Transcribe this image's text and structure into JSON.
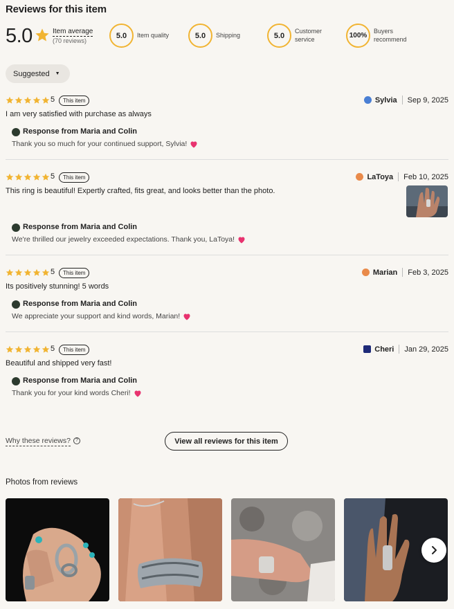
{
  "header": {
    "title": "Reviews for this item"
  },
  "summary": {
    "score": "5.0",
    "avg_label": "Item average",
    "count": "(70 reviews)",
    "star_color": "#f1b432"
  },
  "metrics": [
    {
      "value": "5.0",
      "label": "Item quality"
    },
    {
      "value": "5.0",
      "label": "Shipping"
    },
    {
      "value": "5.0",
      "label_line1": "Customer",
      "label_line2": "service"
    },
    {
      "value": "100%",
      "label_line1": "Buyers",
      "label_line2": "recommend"
    }
  ],
  "sort": {
    "label": "Suggested",
    "caret_icon": "caret-down-icon"
  },
  "reviews": [
    {
      "rating": "5",
      "badge": "This item",
      "text": "I am very satisfied with purchase as always",
      "author": "Sylvia",
      "date": "Sep 9, 2025",
      "avatar_color": "#4a7fd4",
      "response_heading": "Response from Maria and Colin",
      "response_text": "Thank you so much for your continued support, Sylvia!"
    },
    {
      "rating": "5",
      "badge": "This item",
      "text": "This ring is beautiful! Expertly crafted, fits great, and looks better than the photo.",
      "author": "LaToya",
      "date": "Feb 10, 2025",
      "avatar_color": "#e98a4a",
      "response_heading": "Response from Maria and Colin",
      "response_text": "We're thrilled our jewelry exceeded expectations. Thank you, LaToya!"
    },
    {
      "rating": "5",
      "badge": "This item",
      "text": "Its positively stunning! 5 words",
      "author": "Marian",
      "date": "Feb 3, 2025",
      "avatar_color": "#e98a4a",
      "response_heading": "Response from Maria and Colin",
      "response_text": "We appreciate your support and kind words, Marian!"
    },
    {
      "rating": "5",
      "badge": "This item",
      "text": "Beautiful and shipped very fast!",
      "author": "Cheri",
      "date": "Jan 29, 2025",
      "avatar_color": "#1e2a78",
      "response_heading": "Response from Maria and Colin",
      "response_text": "Thank you for your kind words Cheri!"
    }
  ],
  "heart_color": "#e8336f",
  "footer": {
    "why_label": "Why these reviews?",
    "view_all_label": "View all reviews for this item"
  },
  "photos": {
    "title": "Photos from reviews",
    "next_icon": "chevron-right-icon"
  }
}
